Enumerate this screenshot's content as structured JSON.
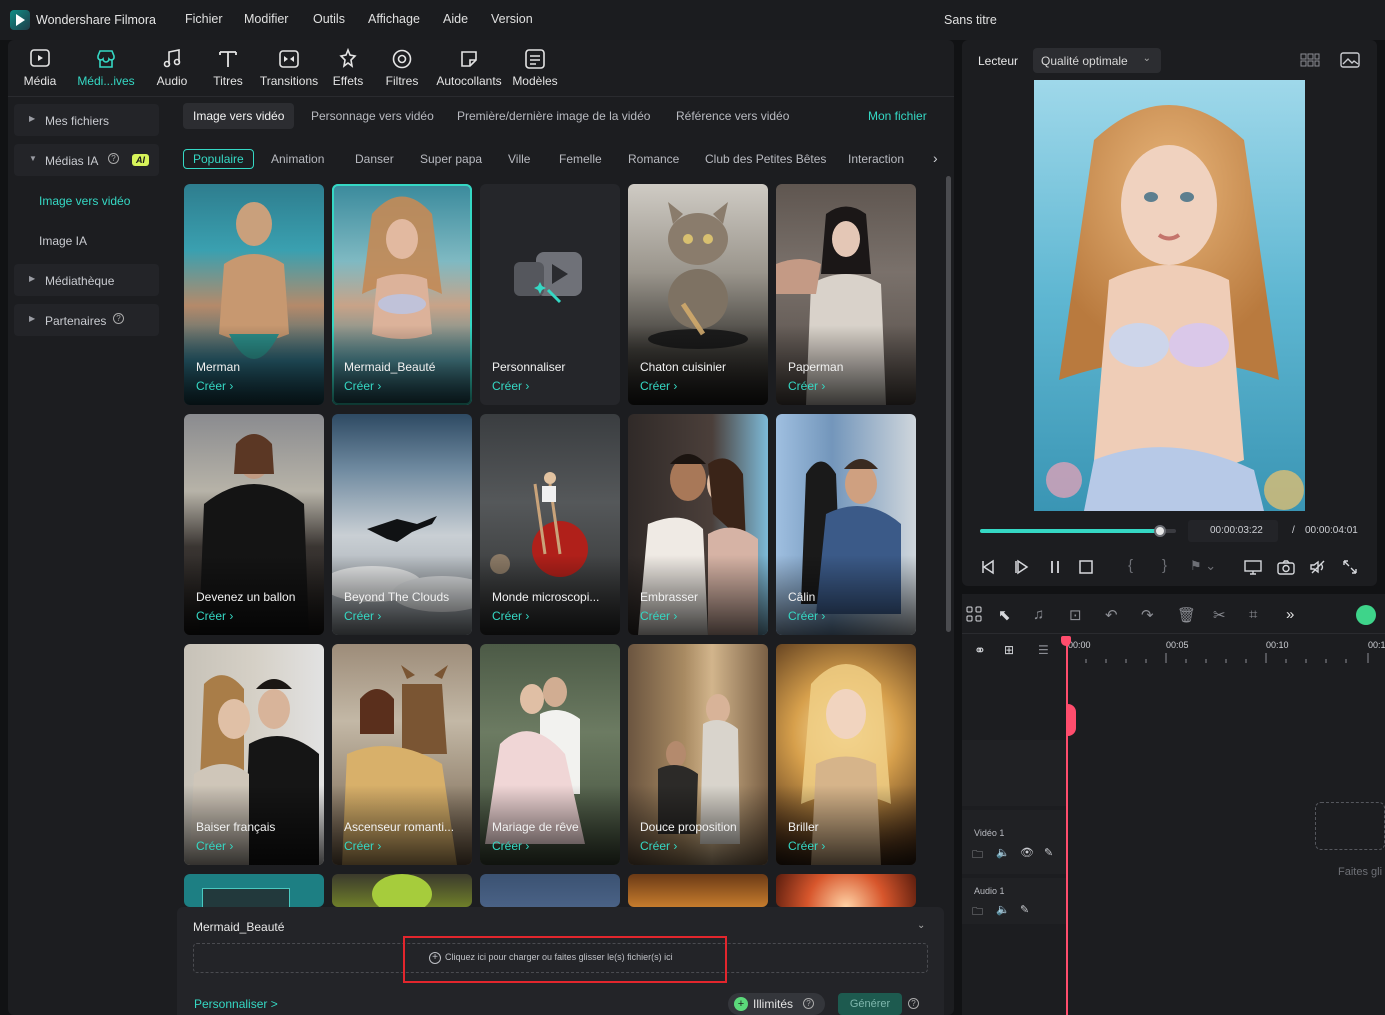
{
  "titlebar": {
    "app_name": "Wondershare Filmora",
    "menu": [
      "Fichier",
      "Modifier",
      "Outils",
      "Affichage",
      "Aide",
      "Version"
    ],
    "document_title": "Sans titre"
  },
  "toolbar": {
    "items": [
      {
        "label": "Média",
        "icon": "media-icon"
      },
      {
        "label": "Médi...ives",
        "icon": "store-icon",
        "active": true
      },
      {
        "label": "Audio",
        "icon": "music-note-icon"
      },
      {
        "label": "Titres",
        "icon": "text-icon"
      },
      {
        "label": "Transitions",
        "icon": "transition-icon"
      },
      {
        "label": "Effets",
        "icon": "effects-icon"
      },
      {
        "label": "Filtres",
        "icon": "filter-icon"
      },
      {
        "label": "Autocollants",
        "icon": "sticker-icon"
      },
      {
        "label": "Modèles",
        "icon": "template-icon"
      }
    ]
  },
  "sidebar": {
    "items": [
      {
        "label": "Mes fichiers"
      },
      {
        "label": "Médias IA",
        "badge": "AI"
      },
      {
        "label": "Image vers vidéo",
        "active": true
      },
      {
        "label": "Image IA"
      },
      {
        "label": "Médiathèque"
      },
      {
        "label": "Partenaires"
      }
    ]
  },
  "tabs": [
    "Image vers vidéo",
    "Personnage vers vidéo",
    "Première/dernière image de la vidéo",
    "Référence vers vidéo"
  ],
  "my_file_link": "Mon fichier",
  "categories": [
    "Populaire",
    "Animation",
    "Danser",
    "Super papa",
    "Ville",
    "Femelle",
    "Romance",
    "Club des Petites Bêtes",
    "Interaction"
  ],
  "create_label": "Créer",
  "cards": [
    {
      "title": "Merman"
    },
    {
      "title": "Mermaid_Beauté",
      "selected": true
    },
    {
      "title": "Personnaliser"
    },
    {
      "title": "Chaton cuisinier"
    },
    {
      "title": "Paperman"
    },
    {
      "title": "Devenez un ballon"
    },
    {
      "title": "Beyond The Clouds"
    },
    {
      "title": "Monde microscopi..."
    },
    {
      "title": "Embrasser"
    },
    {
      "title": "Câlin"
    },
    {
      "title": "Baiser français"
    },
    {
      "title": "Ascenseur romanti..."
    },
    {
      "title": "Mariage de rêve"
    },
    {
      "title": "Douce proposition"
    },
    {
      "title": "Briller"
    }
  ],
  "bottom_panel": {
    "title": "Mermaid_Beauté",
    "drop_text": "Cliquez ici pour charger ou faites glisser le(s) fichier(s) ici",
    "customize_link": "Personnaliser >",
    "credits_label": "Illimités",
    "generate_label": "Générer"
  },
  "player": {
    "label": "Lecteur",
    "quality": "Qualité optimale",
    "current_time": "00:00:03:22",
    "separator": "/",
    "total_time": "00:00:04:01",
    "progress": 0.92
  },
  "timeline": {
    "ruler": [
      "00:00",
      "00:05",
      "00:10",
      "00:1"
    ],
    "video_track": "Vidéo 1",
    "audio_track": "Audio 1",
    "drop_hint": "Faites gli"
  },
  "colors": {
    "accent": "#35d8c4",
    "highlight": "#e3262d",
    "playhead": "#ff4d6d"
  }
}
